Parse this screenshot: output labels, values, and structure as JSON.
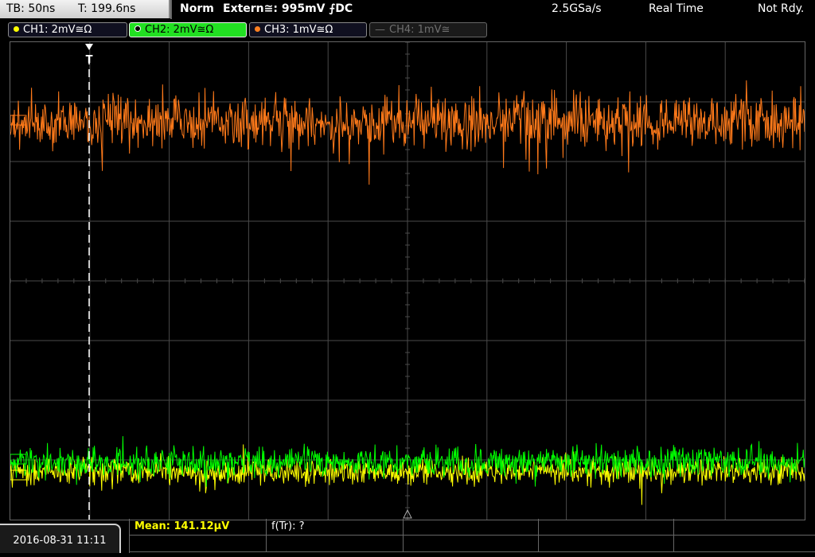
{
  "header": {
    "timebase": "TB: 50ns",
    "trigger_time": "T: 199.6ns",
    "mode": "Norm",
    "trigger_source": "Extern≅: 995mV ⨍DC",
    "sample_rate": "2.5GSa/s",
    "acq_mode": "Real Time",
    "status": "Not Rdy."
  },
  "channels": [
    {
      "label": "CH1: 2mV≅Ω",
      "color": "#ffff00",
      "active": false
    },
    {
      "label": "CH2: 2mV≅Ω",
      "color": "#00ff00",
      "active": true
    },
    {
      "label": "CH3: 1mV≅Ω",
      "color": "#ff8020",
      "active": false
    },
    {
      "label": "CH4: 1mV≅",
      "color": "#8a8a8a",
      "active": false,
      "disabled": true
    }
  ],
  "trigger_marker": "T",
  "footer": {
    "datetime": "2016-08-31 11:11",
    "measurement_1": "Mean: 141.12µV",
    "measurement_2": "f(Tr): ?"
  },
  "colors": {
    "ch1": "#ffff00",
    "ch2": "#00ff00",
    "ch3": "#ff7a1a",
    "grid": "#4a4a4a",
    "measurement_text": "#ffff00"
  }
}
